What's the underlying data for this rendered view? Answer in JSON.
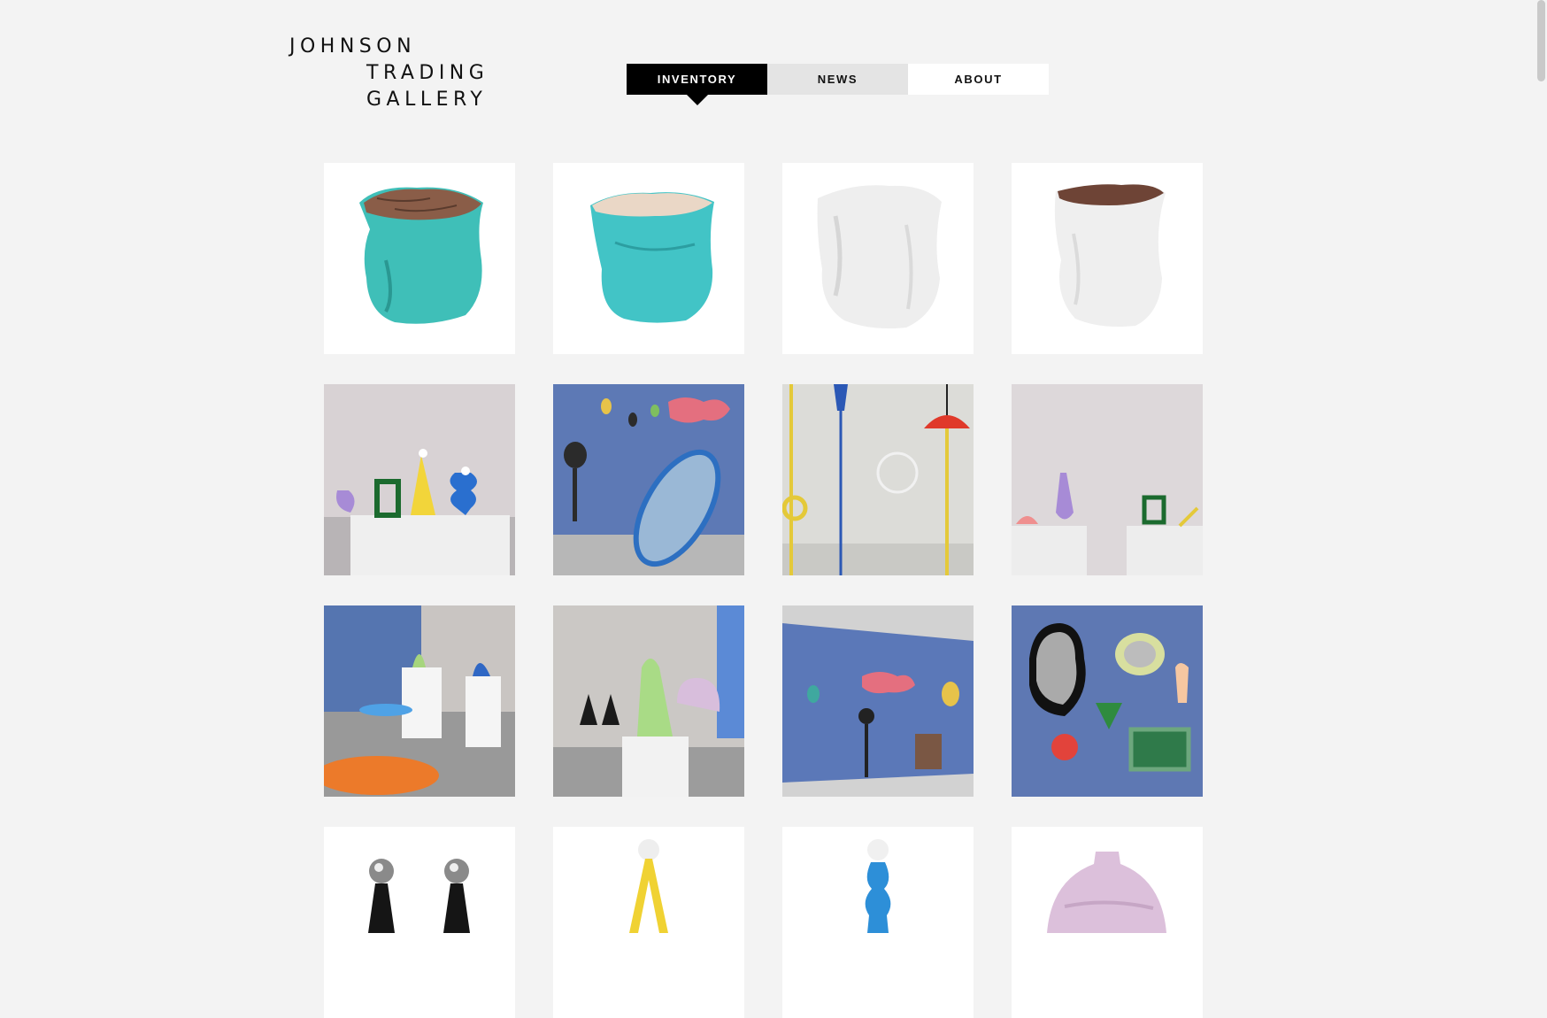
{
  "logo": {
    "line1": "JOHNSON",
    "line2": "TRADING",
    "line3": "GALLERY"
  },
  "nav": {
    "inventory": "INVENTORY",
    "news": "NEWS",
    "about": "ABOUT",
    "active": "inventory"
  },
  "colors": {
    "background": "#f3f3f3",
    "accent": "#000000",
    "turquoise": "#3fc0bb"
  },
  "grid": {
    "items": [
      {
        "name": "turquoise-stool-wood-top",
        "kind": "product"
      },
      {
        "name": "turquoise-stool-light-top",
        "kind": "product"
      },
      {
        "name": "white-stool",
        "kind": "product"
      },
      {
        "name": "white-stool-wood-top",
        "kind": "product"
      },
      {
        "name": "lamps-on-pedestal",
        "kind": "photo"
      },
      {
        "name": "mirrors-wall-blue",
        "kind": "photo"
      },
      {
        "name": "hanging-lamps",
        "kind": "photo"
      },
      {
        "name": "pedestal-lamps-pastel",
        "kind": "photo"
      },
      {
        "name": "gallery-room-view",
        "kind": "photo"
      },
      {
        "name": "green-lamp-pedestal",
        "kind": "photo"
      },
      {
        "name": "blue-wall-mirrors-wide",
        "kind": "photo"
      },
      {
        "name": "mirrors-closeup",
        "kind": "photo"
      },
      {
        "name": "black-lamps-pair",
        "kind": "product"
      },
      {
        "name": "yellow-floor-lamp",
        "kind": "product"
      },
      {
        "name": "blue-lamp",
        "kind": "product"
      },
      {
        "name": "pink-vase",
        "kind": "product"
      }
    ]
  }
}
